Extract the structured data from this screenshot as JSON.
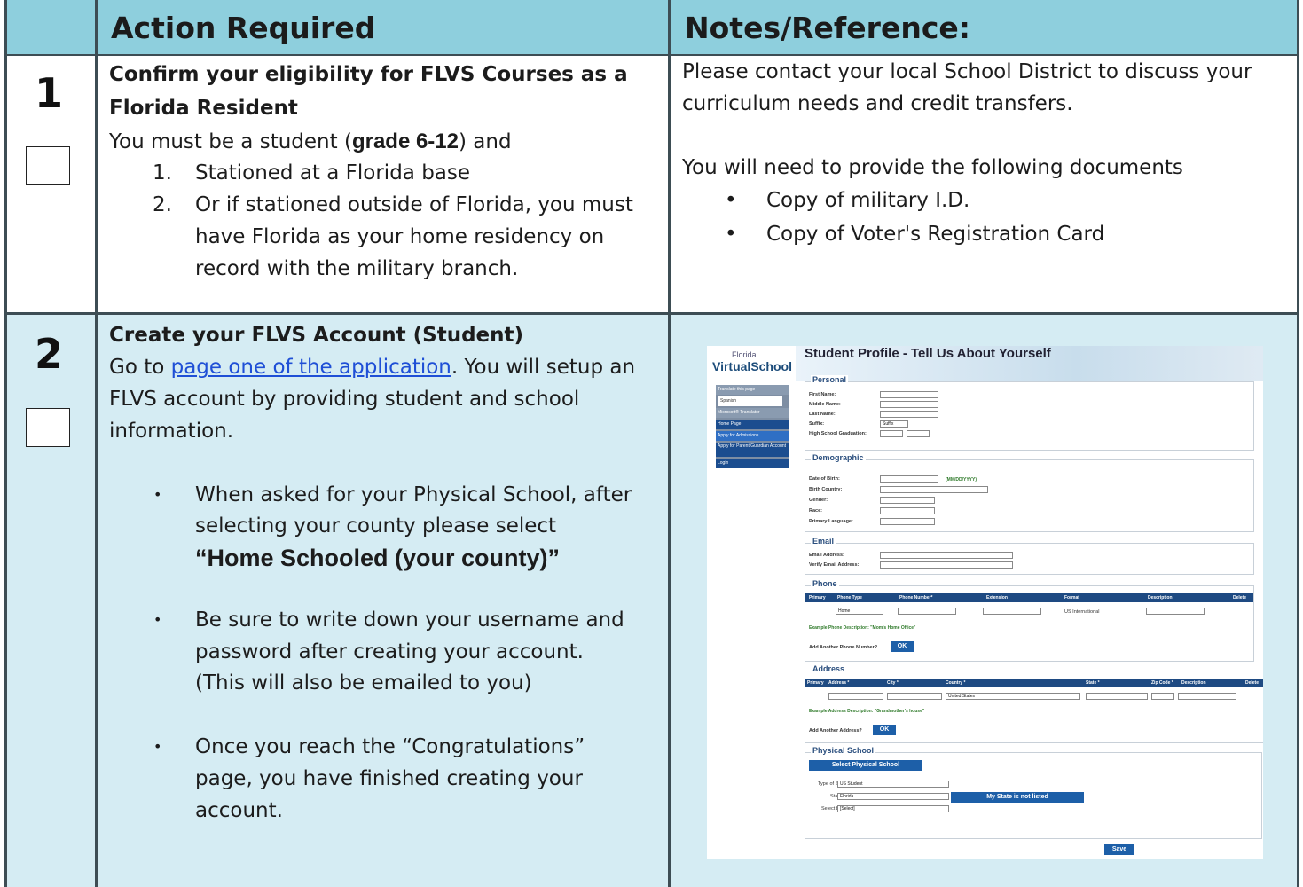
{
  "header": {
    "action_col": "Action Required",
    "notes_col": "Notes/Reference:"
  },
  "rows": [
    {
      "number": "1",
      "action": {
        "title_line1": "Confirm your eligibility for FLVS Courses as a",
        "title_line2": "Florida Resident",
        "intro_pre": "You must be a student (",
        "intro_bold": "grade 6-12",
        "intro_post": ") and",
        "items": [
          {
            "marker": "1.",
            "lines": [
              "Stationed at a Florida base"
            ]
          },
          {
            "marker": "2.",
            "lines": [
              "Or if stationed outside of Florida, you must",
              "have Florida as your home residency on",
              "record with the military branch."
            ]
          }
        ]
      },
      "notes": {
        "line1": "Please contact your local School District to discuss your",
        "line2": "curriculum needs and credit transfers.",
        "docs_intro": "You will need to provide the following documents",
        "docs": [
          "Copy of military I.D.",
          "Copy of Voter's Registration Card"
        ]
      }
    },
    {
      "number": "2",
      "action": {
        "title": "Create your FLVS Account (Student)",
        "goto_pre": "Go to ",
        "goto_link": "page one of the application",
        "goto_post": ". You will setup an",
        "line2": "FLVS account by providing student and school",
        "line3": "information.",
        "bullets": [
          {
            "lines": [
              "When asked for your Physical School, after",
              "selecting your county please select"
            ],
            "bold_line": "“Home Schooled (your county)”"
          },
          {
            "lines": [
              "Be sure to write down your username and",
              "password after creating your account.",
              "(This will also be emailed to you)"
            ]
          },
          {
            "lines": [
              "Once you reach the “Congratulations”",
              "page, you have finished creating your",
              "account."
            ]
          }
        ]
      }
    }
  ],
  "screenshot": {
    "logo_small": "Florida",
    "logo_main": "VirtualSchool",
    "title": "Student Profile - Tell Us About Yourself",
    "sidebar": [
      "Translate this page",
      "Spanish",
      "Microsoft® Translator",
      "Home Page",
      "Apply for Admissions",
      "Apply for Parent/Guardian Account",
      "Login"
    ],
    "sections": {
      "personal": "Personal",
      "demographic": "Demographic",
      "email": "Email",
      "phone": "Phone",
      "address": "Address",
      "physical_school": "Physical School"
    },
    "personal_fields": [
      "First Name:",
      "Middle Name:",
      "Last Name:",
      "Suffix:",
      "High School Graduation:"
    ],
    "demographic_fields": [
      "Date of Birth:",
      "Birth Country:",
      "Gender:",
      "Race:",
      "Primary Language:"
    ],
    "date_format": "(MM/DD/YYYY)",
    "email_fields": [
      "Email Address:",
      "Verify Email Address:"
    ],
    "phone_headers": [
      "Primary",
      "Phone Type",
      "Phone Number*",
      "Extension",
      "Format",
      "Description",
      "Delete"
    ],
    "phone_type": "Home",
    "phone_format": "US  International",
    "phone_example": "Example Phone Description: \"Mom's Home Office\"",
    "add_phone": "Add Another Phone Number?",
    "address_headers": [
      "Primary",
      "Address *",
      "City *",
      "Country *",
      "State *",
      "Zip Code *",
      "Description",
      "Delete"
    ],
    "address_country": "United States",
    "address_example": "Example Address Description: \"Grandmother's house\"",
    "add_address": "Add Another Address?",
    "ok": "OK",
    "select_school": "Select Physical School",
    "type_label": "Type of Student",
    "type_value": "US Student",
    "state_label": "State",
    "state_value": "Florida",
    "not_listed": "My State is not listed",
    "select_by_label": "Select by",
    "select_value": "[Select]",
    "suffix_value": "Suffix",
    "save": "Save"
  }
}
